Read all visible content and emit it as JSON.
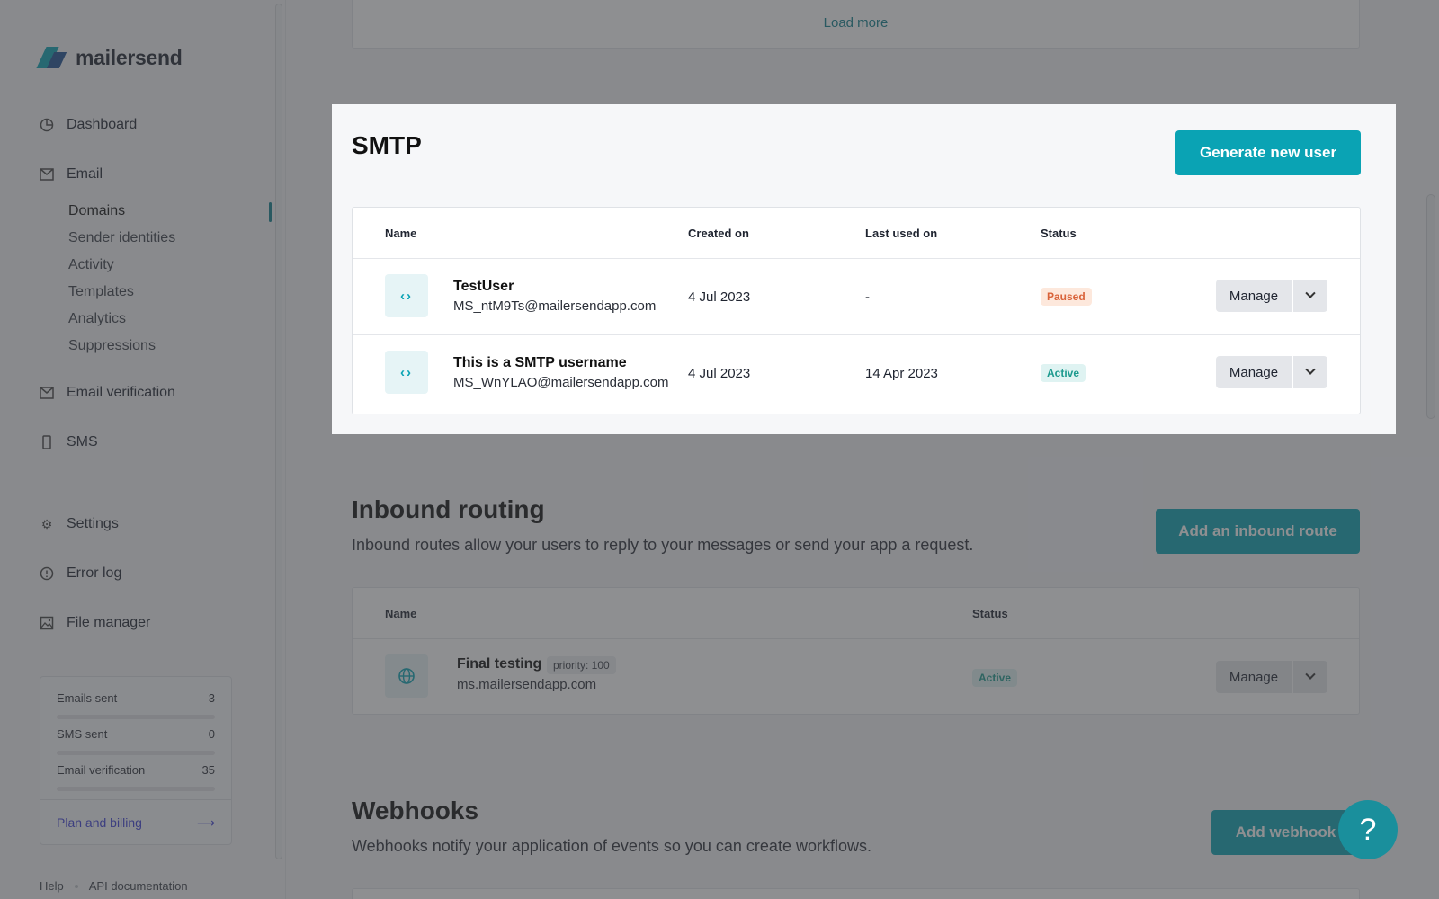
{
  "brand": {
    "name": "mailersend"
  },
  "sidebar": {
    "nav": [
      {
        "label": "Dashboard",
        "icon": "dashboard-icon"
      },
      {
        "label": "Email",
        "icon": "email-icon"
      },
      {
        "label": "Email verification",
        "icon": "email-verification-icon"
      },
      {
        "label": "SMS",
        "icon": "sms-icon"
      },
      {
        "label": "Settings",
        "icon": "gear-icon"
      },
      {
        "label": "Error log",
        "icon": "error-icon"
      },
      {
        "label": "File manager",
        "icon": "image-icon"
      }
    ],
    "email_sub": [
      "Domains",
      "Sender identities",
      "Activity",
      "Templates",
      "Analytics",
      "Suppressions"
    ],
    "active_sub": "Domains",
    "usage": {
      "rows": [
        {
          "label": "Emails sent",
          "value": "3"
        },
        {
          "label": "SMS sent",
          "value": "0"
        },
        {
          "label": "Email verification",
          "value": "35"
        }
      ],
      "plan_link": "Plan and billing",
      "plan_arrow": "⟶"
    },
    "footer": {
      "help": "Help",
      "api": "API documentation"
    }
  },
  "main": {
    "load_more": "Load more",
    "smtp": {
      "title": "SMTP",
      "button": "Generate new user",
      "columns": [
        "Name",
        "Created on",
        "Last used on",
        "Status"
      ],
      "rows": [
        {
          "name": "TestUser",
          "email": "MS_ntM9Ts@mailersendapp.com",
          "created": "4 Jul 2023",
          "last_used": "-",
          "status": "Paused",
          "manage": "Manage"
        },
        {
          "name": "This is a SMTP username",
          "email": "MS_WnYLAO@mailersendapp.com",
          "created": "4 Jul 2023",
          "last_used": "14 Apr 2023",
          "status": "Active",
          "manage": "Manage"
        }
      ]
    },
    "inbound": {
      "title": "Inbound routing",
      "description": "Inbound routes allow your users to reply to your messages or send your app a request.",
      "button": "Add an inbound route",
      "columns": [
        "Name",
        "Status"
      ],
      "rows": [
        {
          "name": "Final testing",
          "priority": "priority: 100",
          "domain": "ms.mailersendapp.com",
          "status": "Active",
          "manage": "Manage"
        }
      ]
    },
    "webhooks": {
      "title": "Webhooks",
      "description": "Webhooks notify your application of events so you can create workflows.",
      "button": "Add webhook"
    },
    "help_button": "?"
  },
  "colors": {
    "accent": "#0aa3b4",
    "link": "#0f7f8c",
    "paused": "#d9633a",
    "active": "#1c9a8e"
  }
}
